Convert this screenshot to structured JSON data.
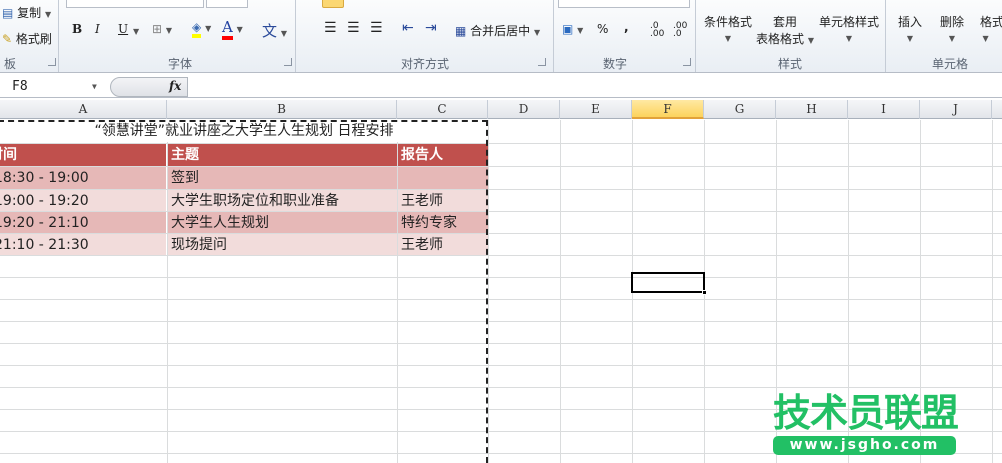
{
  "ribbon": {
    "clipboard": {
      "copy": "复制",
      "format_painter": "格式刷",
      "group": "板"
    },
    "font": {
      "bold": "B",
      "italic": "I",
      "underline": "U",
      "font_color_glyph": "A",
      "phonetic_glyph": "文",
      "group": "字体",
      "fill_color": "#ffff00",
      "font_color": "#ff0000"
    },
    "alignment": {
      "merge_center": "合并后居中",
      "group": "对齐方式"
    },
    "number": {
      "percent": "%",
      "comma": ",",
      "increase_decimal": ".0 .00",
      "decrease_decimal": ".00 .0",
      "group": "数字"
    },
    "styles": {
      "conditional": "条件格式",
      "table_format_1": "套用",
      "table_format_2": "表格格式",
      "cell_styles": "单元格样式",
      "group": "样式"
    },
    "cells": {
      "insert": "插入",
      "delete": "删除",
      "format": "格式",
      "group": "单元格"
    }
  },
  "formula_bar": {
    "name_box": "F8",
    "fx": "fx",
    "value": ""
  },
  "columns": [
    "A",
    "B",
    "C",
    "D",
    "E",
    "F",
    "G",
    "H",
    "I",
    "J"
  ],
  "selected_cell": "F8",
  "sheet": {
    "title": "“领慧讲堂”就业讲座之大学生人生规划 日程安排",
    "headers": [
      "时间",
      "主题",
      "报告人"
    ],
    "rows": [
      [
        "18:30 - 19:00",
        "签到",
        ""
      ],
      [
        "19:00 - 19:20",
        "大学生职场定位和职业准备",
        "王老师"
      ],
      [
        "19:20 - 21:10",
        "大学生人生规划",
        "特约专家"
      ],
      [
        "21:10 - 21:30",
        "现场提问",
        "王老师"
      ]
    ],
    "header_color": "#c0504d",
    "band1": "#e6b8b7",
    "band2": "#f2dcdb"
  },
  "watermark": {
    "name": "技术员联盟",
    "url": "www.jsgho.com",
    "color": "#22c065"
  }
}
